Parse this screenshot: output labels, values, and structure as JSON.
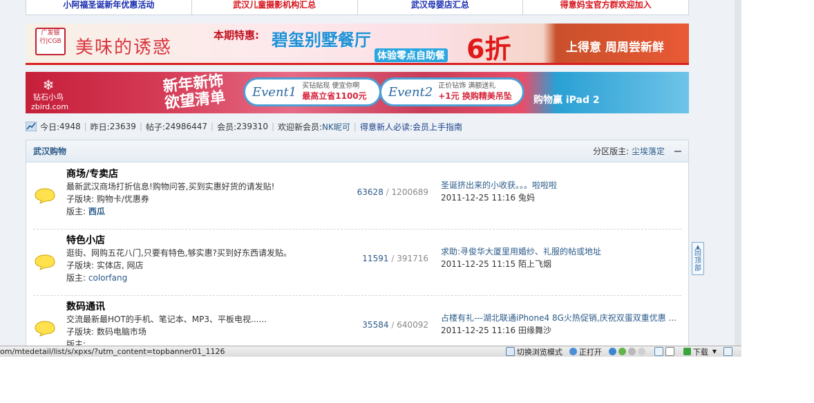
{
  "top_links": [
    {
      "label": "小阿福圣诞新年优惠活动",
      "color": "#1a2fb0"
    },
    {
      "label": "武汉儿童摄影机构汇总",
      "color": "#d6141c"
    },
    {
      "label": "武汉母婴店汇总",
      "color": "#1a2fb0"
    },
    {
      "label": "得意妈宝官方群欢迎加入",
      "color": "#d6141c"
    }
  ],
  "banner1": {
    "logo_text": "广发银行|CGB",
    "title": "美味的诱惑",
    "special_label": "本期特惠:",
    "restaurant": "碧玺别墅餐厅",
    "subtitle": "体验零点自助餐",
    "discount": "6折",
    "right_text": "上得意    周周尝新鲜"
  },
  "banner2": {
    "logo_text": "钻石小鸟\nzbird.com",
    "title": "新年新饰\n欲望清单",
    "event1": {
      "label": "Event1",
      "line1": "买钻贴现 便宜你啊",
      "line2": "最高立省1100元"
    },
    "event2": {
      "label": "Event2",
      "line1": "正价钻饰 满额送礼",
      "line2": "+1元 换购精美吊坠"
    },
    "ipad": "购物赢 iPad 2"
  },
  "stats": {
    "today_label": "今日:",
    "today": "4948",
    "yesterday_label": "昨日:",
    "yesterday": "23639",
    "posts_label": "帖子:",
    "posts": "24986447",
    "members_label": "会员:",
    "members": "239310",
    "welcome_label": "欢迎新会员:",
    "new_member": "NK昵可",
    "guide_link": "得意新人必读:会员上手指南"
  },
  "forum": {
    "title": "武汉购物",
    "moderator_label": "分区版主:",
    "moderator": "尘埃落定",
    "boards": [
      {
        "name": "商场/专卖店",
        "desc": "最新武汉商场打折信息!购物问答,买到实惠好货的请发贴!",
        "sub_label": "子版块:",
        "sub": "购物卡/优惠券",
        "mod_label": "版主:",
        "mod": "西瓜",
        "topics": "63628",
        "posts": "1200689",
        "last_topic": "圣诞挤出来的小收获。。。啦啦啦",
        "last_time": "2011-12-25 11:16",
        "last_user": "兔妈"
      },
      {
        "name": "特色小店",
        "desc": "逛街、网购五花八门,只要有特色,够实惠?买到好东西请发贴。",
        "sub_label": "子版块:",
        "sub": "实体店, 网店",
        "mod_label": "版主:",
        "mod": "colorfang",
        "topics": "11591",
        "posts": "391716",
        "last_topic": "求助:寻俊华大厦里用婚纱、礼服的帖或地址",
        "last_time": "2011-12-25 11:15",
        "last_user": "陌上飞烟"
      },
      {
        "name": "数码通讯",
        "desc": "交流最新最HOT的手机、笔记本、MP3、平板电视......",
        "sub_label": "子版块:",
        "sub": "数码电脑市场",
        "mod_label": "版主:",
        "mod": "",
        "topics": "35584",
        "posts": "640092",
        "last_topic": "占楼有礼---湖北联通iPhone4 8G火热促销,庆祝双蛋双重优惠 ...",
        "last_time": "2011-12-25 11:16",
        "last_user": "田缘舞沙"
      }
    ]
  },
  "back_to_top": "回\n顶\n部",
  "statusbar": {
    "url": "om/mtedetail/list/s/xpxs/?utm_content=topbanner01_1126",
    "switch_mode": "切换浏览模式",
    "opened": "正打开",
    "download": "下载"
  },
  "colors": {
    "accent_blue": "#2b5a89",
    "link_red": "#d6141c",
    "link_blue": "#1a2fb0"
  }
}
